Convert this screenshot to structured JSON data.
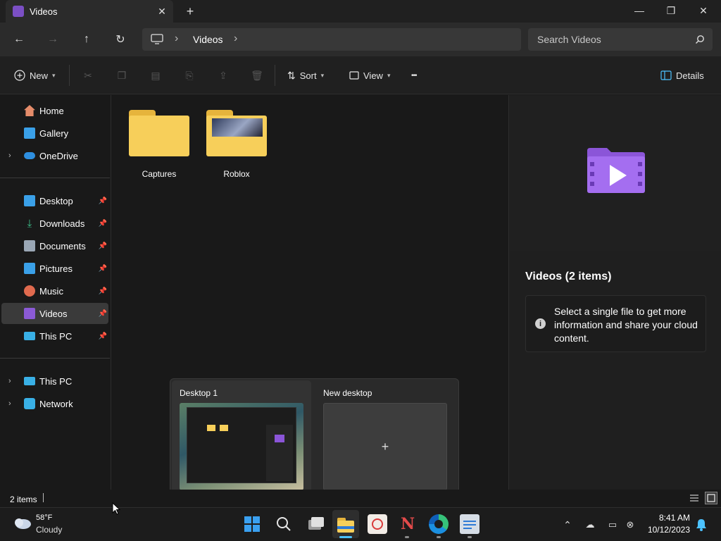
{
  "window": {
    "tab_title": "Videos",
    "close_glyph": "✕",
    "new_tab_glyph": "+",
    "minimize_glyph": "—",
    "restore_glyph": "❐",
    "close_window_glyph": "✕"
  },
  "nav": {
    "back_glyph": "←",
    "forward_glyph": "→",
    "up_glyph": "↑",
    "refresh_glyph": "↻"
  },
  "address": {
    "crumb": "Videos",
    "sep_glyph": "›"
  },
  "search": {
    "placeholder": "Search Videos"
  },
  "commands": {
    "new_label": "New",
    "sort_label": "Sort",
    "view_label": "View",
    "more_glyph": "•••",
    "details_label": "Details"
  },
  "sidebar": {
    "quick": [
      {
        "label": "Home",
        "icon": "home-icon",
        "color": "#e58c6a"
      },
      {
        "label": "Gallery",
        "icon": "gallery-icon",
        "color": "#3aa0e8"
      },
      {
        "label": "OneDrive",
        "icon": "onedrive-icon",
        "color": "#2e8fe0"
      }
    ],
    "pinned": [
      {
        "label": "Desktop",
        "icon": "desktop-icon",
        "color": "#3aa0e8"
      },
      {
        "label": "Downloads",
        "icon": "downloads-icon",
        "color": "#3dc08a"
      },
      {
        "label": "Documents",
        "icon": "documents-icon",
        "color": "#9aa7b5"
      },
      {
        "label": "Pictures",
        "icon": "pictures-icon",
        "color": "#3aa0e8"
      },
      {
        "label": "Music",
        "icon": "music-icon",
        "color": "#e06a4e"
      },
      {
        "label": "Videos",
        "icon": "videos-icon",
        "color": "#8b5ad6"
      },
      {
        "label": "This PC",
        "icon": "this-pc-icon",
        "color": "#39b0e6"
      }
    ],
    "drives": [
      {
        "label": "This PC",
        "icon": "this-pc-icon",
        "color": "#39b0e6"
      },
      {
        "label": "Network",
        "icon": "network-icon",
        "color": "#39b0e6"
      }
    ]
  },
  "content": {
    "folders": [
      {
        "label": "Captures"
      },
      {
        "label": "Roblox"
      }
    ]
  },
  "details": {
    "title": "Videos (2 items)",
    "info": "Select a single file to get more information and share your cloud content."
  },
  "taskview": {
    "desktop1": "Desktop 1",
    "new_desktop": "New desktop",
    "plus_glyph": "+"
  },
  "status": {
    "items": "2 items"
  },
  "taskbar": {
    "temperature": "58°F",
    "condition": "Cloudy",
    "time": "8:41 AM",
    "date": "10/12/2023"
  }
}
